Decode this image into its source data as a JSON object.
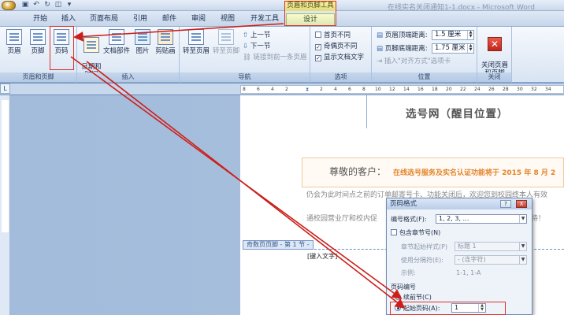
{
  "window": {
    "doc_title": "在线实名关闭通知1-1.docx - Microsoft Word",
    "context_group": "页眉和页脚工具"
  },
  "tabs": [
    "开始",
    "插入",
    "页面布局",
    "引用",
    "邮件",
    "审阅",
    "视图",
    "开发工具",
    "设计"
  ],
  "ribbon": {
    "hf_group": {
      "label": "页眉和页脚",
      "header": "页眉",
      "footer": "页脚",
      "page_number": "页码"
    },
    "insert_group": {
      "label": "插入",
      "datetime": "日期和\n时间",
      "doc_parts": "文档部件",
      "picture": "图片",
      "clipart": "剪贴画"
    },
    "nav_group": {
      "label": "导航",
      "goto_header": "转至页眉",
      "goto_footer": "转至页脚",
      "prev_section": "上一节",
      "next_section": "下一节",
      "link_prev": "链接到前一条页眉"
    },
    "options_group": {
      "label": "选项",
      "first_page_diff": "首页不同",
      "odd_even_diff": "奇偶页不同",
      "show_doc_text": "显示文档文字",
      "first_page_checked": false,
      "odd_even_checked": true,
      "show_doc_text_checked": true
    },
    "position_group": {
      "label": "位置",
      "header_top_label": "页眉顶端距离:",
      "header_top_value": "1.5 厘米",
      "footer_bottom_label": "页脚底端距离:",
      "footer_bottom_value": "1.75 厘米",
      "insert_align_tab": "插入\"对齐方式\"选项卡"
    },
    "close_group": {
      "label": "关闭",
      "close_hf": "关闭页眉\n和页脚"
    }
  },
  "ruler": {
    "ticks": [
      "8",
      "6",
      "4",
      "2",
      "2",
      "4",
      "6",
      "8",
      "10",
      "12",
      "14",
      "16",
      "18",
      "20",
      "22",
      "24",
      "26",
      "28",
      "30",
      "32",
      "34",
      "36"
    ],
    "corner": "L"
  },
  "document": {
    "header_text": "选号网（醒目位置）",
    "greeting": "尊敬的客户：",
    "notice": "在线选号服务及实名认证功能将于 2015 年 8 月 2",
    "body1": "仍会为此时间点之前的订单邮寄号卡、功能关闭后，欢迎您到校园终本人有效",
    "body2": "通校园营业厅和校内促",
    "body2_tail": "待！",
    "footer_tag": "奇数页页脚 - 第 1 节 -",
    "footer_placeholder": "[键入文字]"
  },
  "dialog": {
    "title": "页码格式",
    "help": "?",
    "close": "X",
    "number_format_label": "编号格式(F):",
    "number_format_value": "1, 2, 3, …",
    "include_chapter": "包含章节号(N)",
    "chapter_style_label": "章节起始样式(P)",
    "chapter_style_value": "标题 1",
    "separator_label": "使用分隔符(E):",
    "separator_value": "-  (连字符)",
    "example_label": "示例:",
    "example_value": "1-1, 1-A",
    "page_numbering_label": "页码编号",
    "continue_prev": "续前节(C)",
    "start_at_label": "起始页码(A):",
    "start_at_value": "1"
  }
}
